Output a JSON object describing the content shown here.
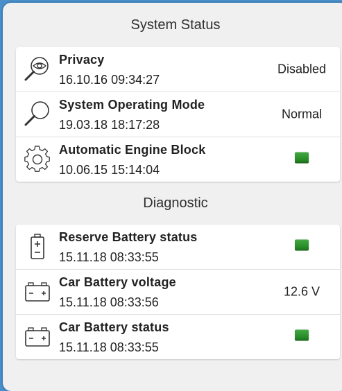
{
  "system_status": {
    "header": "System Status",
    "rows": [
      {
        "icon": "privacy-eye-search-icon",
        "title": "Privacy",
        "time": "16.10.16 09:34:27",
        "value": "Disabled",
        "value_type": "text"
      },
      {
        "icon": "magnifier-icon",
        "title": "System Operating Mode",
        "time": "19.03.18 18:17:28",
        "value": "Normal",
        "value_type": "text"
      },
      {
        "icon": "gear-icon",
        "title": "Automatic Engine Block",
        "time": "10.06.15 15:14:04",
        "value": "",
        "value_type": "indicator",
        "indicator_color": "#2a8f2a"
      }
    ]
  },
  "diagnostic": {
    "header": "Diagnostic",
    "rows": [
      {
        "icon": "reserve-battery-icon",
        "title": "Reserve Battery status",
        "time": "15.11.18 08:33:55",
        "value": "",
        "value_type": "indicator",
        "indicator_color": "#2a8f2a"
      },
      {
        "icon": "car-battery-icon",
        "title": "Car Battery voltage",
        "time": "15.11.18 08:33:56",
        "value": "12.6 V",
        "value_type": "text"
      },
      {
        "icon": "car-battery-icon",
        "title": "Car Battery status",
        "time": "15.11.18 08:33:55",
        "value": "",
        "value_type": "indicator",
        "indicator_color": "#2a8f2a"
      }
    ]
  },
  "colors": {
    "frame_border": "#3d7fb9",
    "page_background": "#f0f0f0",
    "status_ok": "#2a8f2a"
  }
}
